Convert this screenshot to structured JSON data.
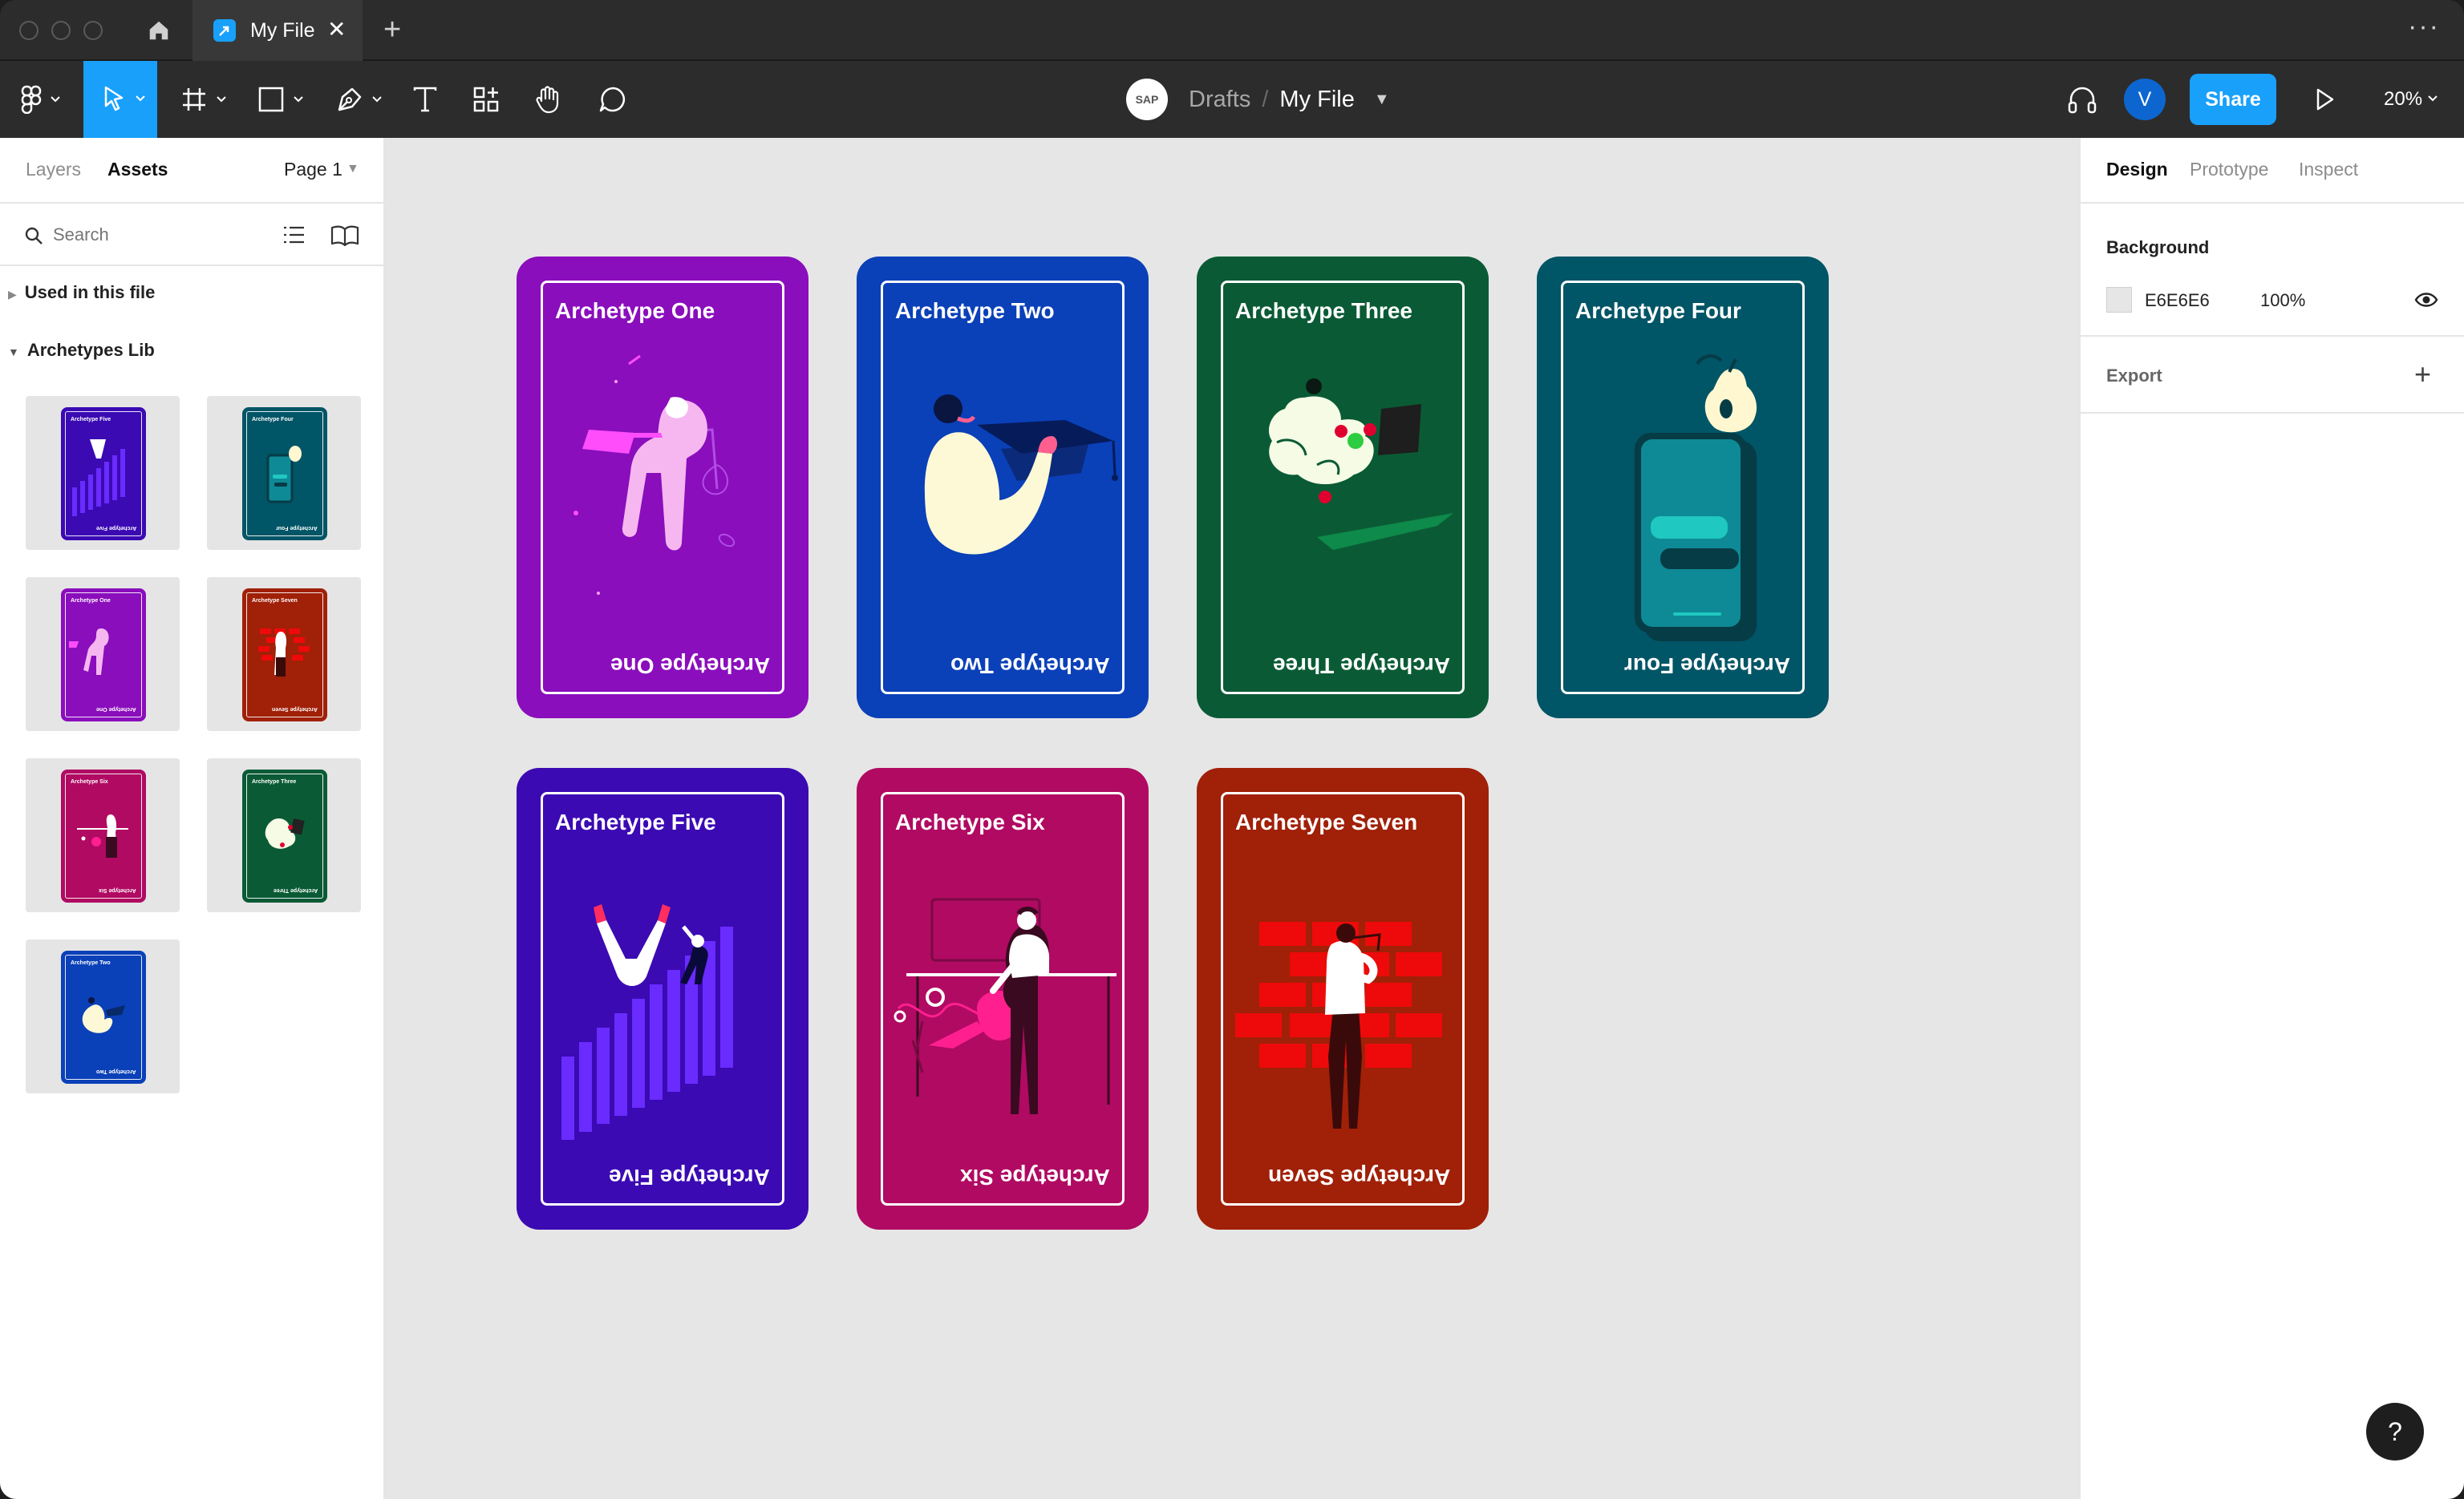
{
  "window": {
    "tab_title": "My File",
    "tab_close": "✕",
    "new_tab": "+",
    "more": "···"
  },
  "toolbar": {
    "breadcrumb_parent": "Drafts",
    "breadcrumb_separator": "/",
    "breadcrumb_file": "My File",
    "logo_text": "SAP",
    "avatar_initial": "V",
    "share_label": "Share",
    "zoom_level": "20%"
  },
  "left_panel": {
    "tabs": [
      "Layers",
      "Assets"
    ],
    "active_tab": "Assets",
    "page_selector": "Page 1",
    "search_placeholder": "Search",
    "sections": [
      {
        "label": "Used in this file",
        "expanded": false
      },
      {
        "label": "Archetypes Lib",
        "expanded": true
      }
    ],
    "assets": [
      {
        "title": "Archetype Five",
        "color": "#3b0ab3"
      },
      {
        "title": "Archetype Four",
        "color": "#005566"
      },
      {
        "title": "Archetype One",
        "color": "#8a0ebc"
      },
      {
        "title": "Archetype Seven",
        "color": "#a02008"
      },
      {
        "title": "Archetype Six",
        "color": "#b00a62"
      },
      {
        "title": "Archetype Three",
        "color": "#0a5b35"
      },
      {
        "title": "Archetype Two",
        "color": "#0a40b8"
      }
    ]
  },
  "canvas": {
    "background": "#E6E6E6",
    "cards": [
      {
        "title": "Archetype One",
        "color": "#8a0ebc"
      },
      {
        "title": "Archetype Two",
        "color": "#0a40b8"
      },
      {
        "title": "Archetype Three",
        "color": "#0a5b35"
      },
      {
        "title": "Archetype Four",
        "color": "#005566"
      },
      {
        "title": "Archetype Five",
        "color": "#3b0ab3"
      },
      {
        "title": "Archetype Six",
        "color": "#b00a62"
      },
      {
        "title": "Archetype Seven",
        "color": "#a02008"
      }
    ]
  },
  "right_panel": {
    "tabs": [
      "Design",
      "Prototype",
      "Inspect"
    ],
    "active_tab": "Design",
    "background_label": "Background",
    "background_hex": "E6E6E6",
    "background_opacity": "100%",
    "export_label": "Export",
    "export_add": "+"
  },
  "help_label": "?"
}
